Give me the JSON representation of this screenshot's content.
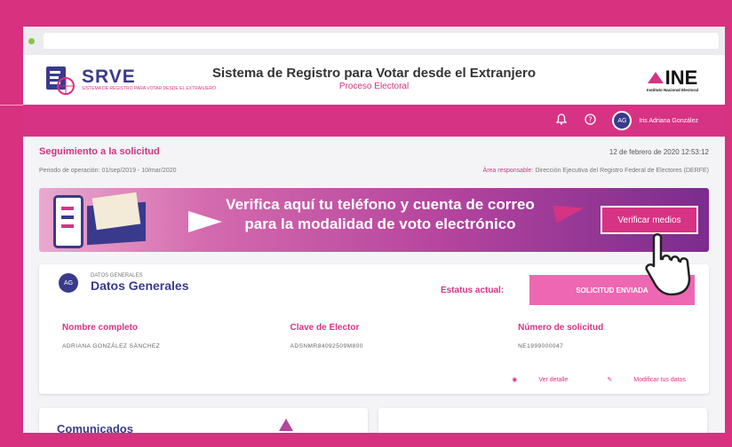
{
  "header": {
    "brand": "SRVE",
    "brand_sub": "SISTEMA DE REGISTRO PARA VOTAR DESDE EL EXTRANJERO",
    "title": "Sistema de Registro para Votar desde el Extranjero",
    "subtitle": "Proceso Electoral",
    "ine_logo": "INE",
    "ine_sub": "Instituto Nacional Electoral"
  },
  "topbar": {
    "avatar_initials": "AG",
    "user_name": "Iris Adriana González"
  },
  "page": {
    "section_title": "Seguimiento a la solicitud",
    "timestamp": "12 de febrero de 2020 12:53:12",
    "period": "Periodo de operación: 01/sep/2019 - 10/mar/2020",
    "area_label": "Área responsable:",
    "area_value": "Dirección Ejecutiva del Registro Federal de Electores (DERFE)"
  },
  "banner": {
    "line1": "Verifica aquí tu teléfono y cuenta de correo",
    "line2": "para la modalidad de voto electrónico",
    "button": "Verificar medios"
  },
  "card": {
    "avatar_initials": "AG",
    "subtitle": "DATOS GENERALES",
    "title": "Datos Generales",
    "status_label": "Estatus actual:",
    "status_value": "SOLICITUD ENVIADA",
    "fields": [
      {
        "label": "Nombre completo",
        "value": "ADRIANA GONZÁLEZ SÁNCHEZ"
      },
      {
        "label": "Clave de Elector",
        "value": "ADSNMR84092509M800"
      },
      {
        "label": "Número de solicitud",
        "value": "NE1999000047"
      }
    ],
    "link_view": "Ver detalle",
    "link_edit": "Modificar tus datos"
  },
  "bottom": {
    "left_title": "Comunicados"
  },
  "colors": {
    "brand_pink": "#d63384",
    "navy": "#3a3a8c"
  }
}
